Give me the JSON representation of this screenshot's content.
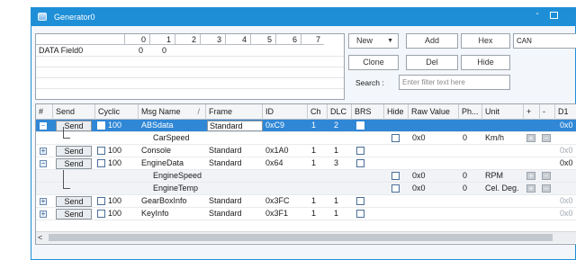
{
  "window": {
    "title": "Generator0",
    "minimize_glyph": "-"
  },
  "data_field": {
    "columns": [
      "0",
      "1",
      "2",
      "3",
      "4",
      "5",
      "6",
      "7"
    ],
    "row_label": "DATA Field0",
    "row_values": [
      "0",
      "0"
    ]
  },
  "controls": {
    "new_label": "New",
    "add_label": "Add",
    "hex_label": "Hex",
    "protocol_value": "CAN",
    "clone_label": "Clone",
    "del_label": "Del",
    "hide_label": "Hide",
    "search_label": "Search :",
    "search_placeholder": "Enter filter text here"
  },
  "table": {
    "headers": {
      "hash": "#",
      "send": "Send",
      "cyclic": "Cyclic",
      "msg_name": "Msg Name",
      "sort_glyph": "/",
      "frame": "Frame",
      "id": "ID",
      "ch": "Ch",
      "dlc": "DLC",
      "brs": "BRS",
      "hide": "Hide",
      "raw_value": "Raw Value",
      "ph": "Ph...",
      "unit": "Unit",
      "plus": "+",
      "minus": "-",
      "d1": "D1"
    },
    "send_label": "Send",
    "rows": [
      {
        "type": "msg",
        "expander": "−",
        "cyclic": "100",
        "name": "ABSdata",
        "frame": "Standard",
        "id": "0xC9",
        "ch": "1",
        "dlc": "2",
        "d1": "0x0",
        "selected": true
      },
      {
        "type": "signal",
        "name": "CarSpeed",
        "raw": "0x0",
        "ph": "0",
        "unit": "Km/h"
      },
      {
        "type": "msg",
        "expander": "+",
        "cyclic": "100",
        "name": "Console",
        "frame": "Standard",
        "id": "0x1A0",
        "ch": "1",
        "dlc": "1",
        "d1": "0x0"
      },
      {
        "type": "msg",
        "expander": "−",
        "cyclic": "100",
        "name": "EngineData",
        "frame": "Standard",
        "id": "0x64",
        "ch": "1",
        "dlc": "3",
        "d1": "0x0"
      },
      {
        "type": "signal",
        "name": "EngineSpeed",
        "raw": "0x0",
        "ph": "0",
        "unit": "RPM"
      },
      {
        "type": "signal",
        "name": "EngineTemp",
        "raw": "0x0",
        "ph": "0",
        "unit": "Cel. Deg."
      },
      {
        "type": "msg",
        "expander": "+",
        "cyclic": "100",
        "name": "GearBoxInfo",
        "frame": "Standard",
        "id": "0x3FC",
        "ch": "1",
        "dlc": "1",
        "d1": "0x0"
      },
      {
        "type": "msg",
        "expander": "+",
        "cyclic": "100",
        "name": "KeyInfo",
        "frame": "Standard",
        "id": "0x3F1",
        "ch": "1",
        "dlc": "1",
        "d1": "0x0"
      }
    ],
    "scroll_left_glyph": "<"
  },
  "colors": {
    "titlebar": "#1e8fd7",
    "selection": "#2f87d6"
  }
}
